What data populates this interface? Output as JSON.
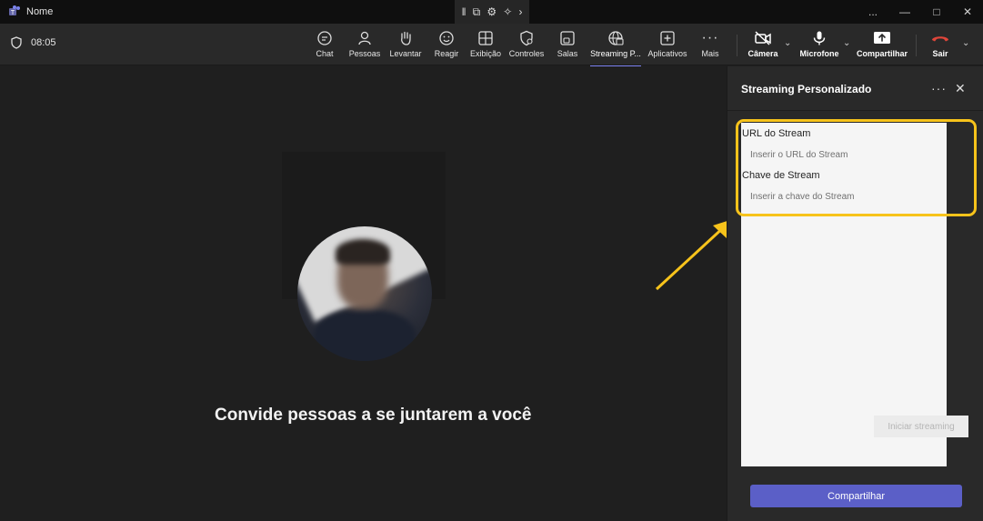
{
  "window": {
    "title": "Nome",
    "controls": [
      "...",
      "—",
      "□",
      "✕"
    ]
  },
  "toolbar": {
    "timer": "08:05",
    "items": [
      {
        "label": "Chat",
        "icon": "chat-icon"
      },
      {
        "label": "Pessoas",
        "icon": "people-icon"
      },
      {
        "label": "Levantar",
        "icon": "raise-hand-icon"
      },
      {
        "label": "Reagir",
        "icon": "react-icon"
      },
      {
        "label": "Exibição",
        "icon": "view-icon"
      },
      {
        "label": "Controles",
        "icon": "controls-icon"
      },
      {
        "label": "Salas",
        "icon": "rooms-icon"
      },
      {
        "label": "Streaming P...",
        "icon": "streaming-icon"
      },
      {
        "label": "Aplicativos",
        "icon": "apps-icon"
      },
      {
        "label": "Mais",
        "icon": "more-icon"
      }
    ],
    "camera_label": "Câmera",
    "mic_label": "Microfone",
    "share_label": "Compartilhar",
    "leave_label": "Sair"
  },
  "stage": {
    "invite_text": "Convide pessoas a se juntarem a você"
  },
  "panel": {
    "title": "Streaming Personalizado",
    "url_label": "URL do Stream",
    "url_placeholder": "Inserir o URL do Stream",
    "key_label": "Chave de Stream",
    "key_placeholder": "Inserir a chave do Stream",
    "start_label": "Iniciar streaming",
    "share_button": "Compartilhar"
  },
  "colors": {
    "accent": "#5b5fc7",
    "highlight": "#f7c31b",
    "leave": "#c4314b",
    "active_underline": "#7f85f5"
  }
}
